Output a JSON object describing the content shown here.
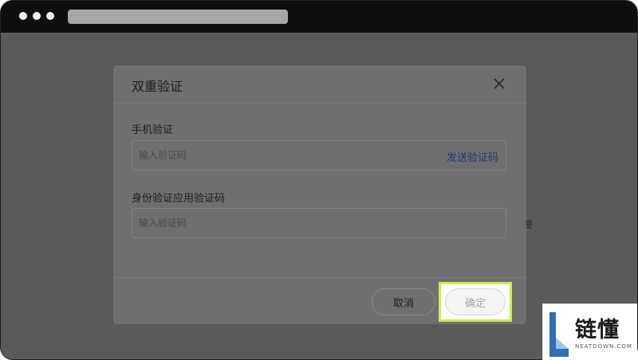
{
  "window": {
    "controls": [
      "dot-icon",
      "dot-icon",
      "dot-icon"
    ]
  },
  "background": {
    "stray_text": "要"
  },
  "dialog": {
    "title": "双重验证",
    "phone": {
      "label": "手机验证",
      "placeholder": "输入验证码",
      "send_code_label": "发送验证码"
    },
    "authenticator": {
      "label": "身份验证应用验证码",
      "placeholder": "输入验证码"
    },
    "cancel_label": "取消",
    "confirm_label": "确定"
  },
  "watermark": {
    "name": "链懂",
    "domain": "NEATDOWN.COM"
  },
  "colors": {
    "overlay": "#5a5a5a",
    "dialog": "#6f6f6f",
    "link": "#1d3a70",
    "highlight": "#c9f24a",
    "brand_blue": "#2f6fb5"
  }
}
